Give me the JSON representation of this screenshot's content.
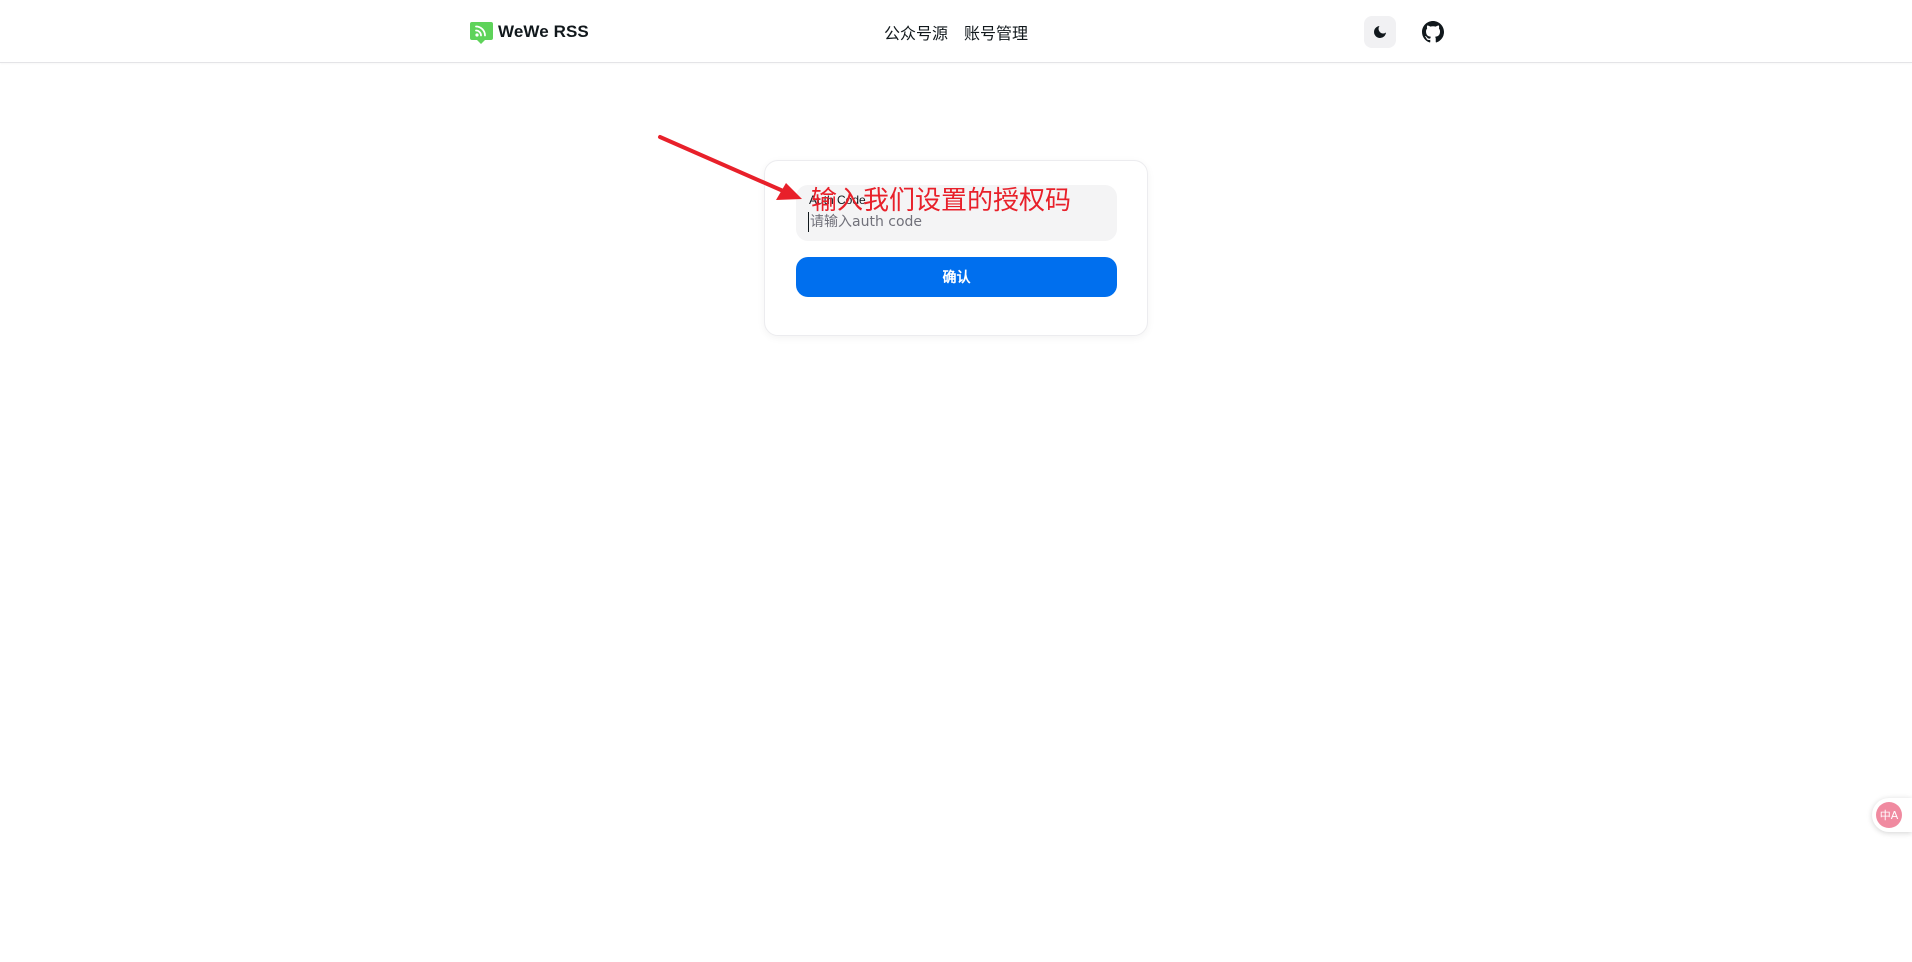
{
  "navbar": {
    "brand": {
      "name": "WeWe RSS",
      "logo_icon": "rss-chat-logo-icon",
      "logo_color": "#5ed35a"
    },
    "links": [
      {
        "label": "公众号源"
      },
      {
        "label": "账号管理"
      }
    ],
    "theme_toggle_icon": "moon-icon",
    "github_icon": "github-icon"
  },
  "login": {
    "input_label": "Auth Code",
    "input_placeholder": "请输入auth code",
    "input_value": "",
    "confirm_label": "确认",
    "accent_color": "#006fee"
  },
  "annotation": {
    "text": "输入我们设置的授权码",
    "color": "#e8202a"
  },
  "floating": {
    "translate_icon": "translate-icon",
    "translate_glyph": "中A"
  }
}
